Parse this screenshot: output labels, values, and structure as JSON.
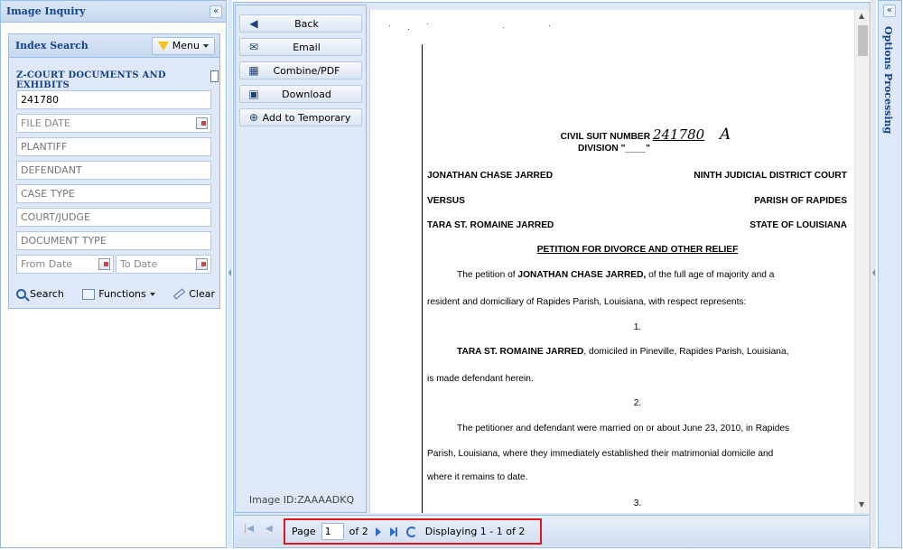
{
  "left_panel": {
    "title": "Image Inquiry",
    "collapse_glyph": "«",
    "index_search": {
      "title": "Index Search",
      "menu_label": "Menu",
      "doc_type_title": "Z-COURT DOCUMENTS AND EXHIBITS",
      "fields": {
        "case_number_value": "241780",
        "file_date_placeholder": "FILE DATE",
        "plantiff_placeholder": "PLANTIFF",
        "defendant_placeholder": "DEFENDANT",
        "case_type_placeholder": "CASE TYPE",
        "court_judge_placeholder": "COURT/JUDGE",
        "document_type_placeholder": "DOCUMENT TYPE",
        "from_date_placeholder": "From Date",
        "to_date_placeholder": "To Date"
      },
      "actions": {
        "search_label": "Search",
        "functions_label": "Functions",
        "clear_label": "Clear"
      }
    }
  },
  "viewer": {
    "toolbar": {
      "back": "Back",
      "email": "Email",
      "combine": "Combine/PDF",
      "download": "Download",
      "add_temp": "Add to Temporary"
    },
    "image_id": "Image ID:ZAAAADKQ",
    "document": {
      "civil_suit_label": "CIVIL SUIT NUMBER",
      "civil_suit_handwritten": "241780",
      "division_label": "DIVISION \"",
      "division_blank": "____",
      "division_close": "\"",
      "handwritten_letter": "A",
      "plaintiff": "JONATHAN CHASE JARRED",
      "court": "NINTH JUDICIAL DISTRICT COURT",
      "versus": "VERSUS",
      "parish": "PARISH OF RAPIDES",
      "defendant": "TARA ST. ROMAINE JARRED",
      "state": "STATE OF LOUISIANA",
      "heading": "PETITION FOR DIVORCE AND OTHER RELIEF",
      "p1_a": "The petition of ",
      "p1_b": "JONATHAN CHASE JARRED,",
      "p1_c": " of the full age of majority and a",
      "p1_line2": "resident and domiciliary of Rapides Parish, Louisiana, with respect represents:",
      "num1": "1.",
      "p2_a": "TARA ST. ROMAINE JARRED",
      "p2_b": ", domiciled in Pineville, Rapides Parish, Louisiana,",
      "p2_line2": "is made defendant herein.",
      "num2": "2.",
      "p3_line1": "The petitioner and defendant were married on or about June 23, 2010, in Rapides",
      "p3_line2": "Parish, Louisiana, where they immediately established their matrimonial domicile and",
      "p3_line3": "where it remains to date.",
      "num3": "3."
    },
    "pager": {
      "page_label": "Page",
      "page_value": "1",
      "of_label": "of 2",
      "displaying": "Displaying 1 - 1 of 2"
    }
  },
  "right_panel": {
    "title": "Options Processing",
    "collapse_glyph": "«"
  }
}
